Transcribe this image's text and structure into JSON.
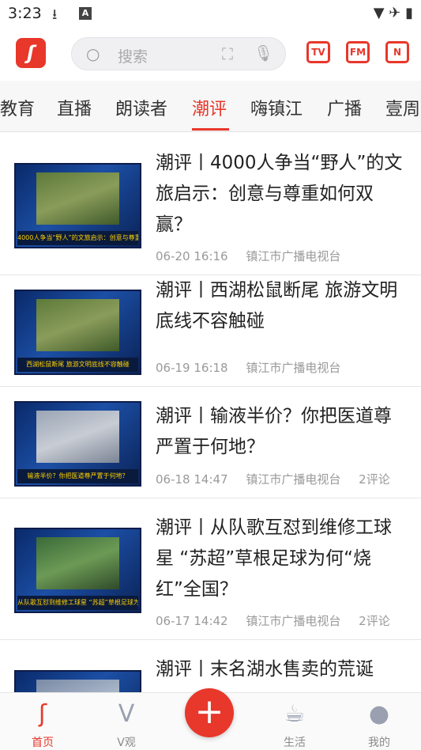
{
  "status_bar": {
    "time": "3:23",
    "right_icons": "▼ ✈ ▮"
  },
  "search": {
    "placeholder": "搜索"
  },
  "header_icons": {
    "tv": "TV",
    "radio": "FM",
    "news": "N"
  },
  "tabs": [
    {
      "label": "教育"
    },
    {
      "label": "直播"
    },
    {
      "label": "朗读者"
    },
    {
      "label": "潮评"
    },
    {
      "label": "嗨镇江"
    },
    {
      "label": "广播"
    },
    {
      "label": "壹周"
    }
  ],
  "articles": [
    {
      "title": "潮评丨4000人争当“野人”的文旅启示：创意与尊重如何双赢？",
      "date": "06-20 16:16",
      "source": "镇江市广播电视台",
      "comments": "",
      "thumb_caption": "4000人争当“野人”的文旅启示：创意与尊重如何双赢?"
    },
    {
      "title": "潮评丨西湖松鼠断尾 旅游文明底线不容触碰",
      "date": "06-19 16:18",
      "source": "镇江市广播电视台",
      "comments": "",
      "thumb_caption": "西湖松鼠断尾  旅游文明底线不容触碰"
    },
    {
      "title": "潮评丨输液半价？你把医道尊严置于何地？",
      "date": "06-18 14:47",
      "source": "镇江市广播电视台",
      "comments": "2评论",
      "thumb_caption": "输液半价？你把医道尊严置于何地？"
    },
    {
      "title": "潮评丨从队歌互怼到维修工球星 “苏超”草根足球为何“烧红”全国？",
      "date": "06-17 14:42",
      "source": "镇江市广播电视台",
      "comments": "2评论",
      "thumb_caption": "从队歌互怼到维修工球星 “苏超”草根足球为何“烧红”全国"
    },
    {
      "title": "潮评丨末名湖水售卖的荒诞",
      "date": "",
      "source": "",
      "comments": "",
      "thumb_caption": ""
    }
  ],
  "bottom_nav": [
    {
      "label": "首页",
      "icon": "home-icon"
    },
    {
      "label": "V观",
      "icon": "video-icon"
    },
    {
      "label": "",
      "icon": "plus-icon"
    },
    {
      "label": "生活",
      "icon": "coffee-icon"
    },
    {
      "label": "我的",
      "icon": "user-icon"
    }
  ],
  "colors": {
    "accent": "#e8372b"
  }
}
